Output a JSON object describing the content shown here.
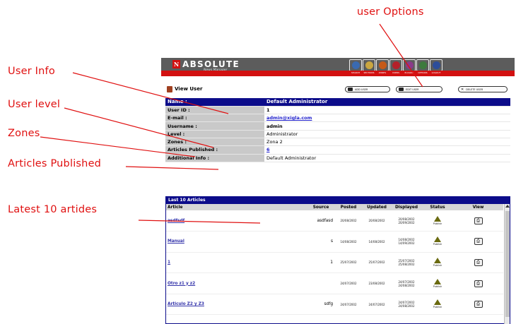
{
  "callouts": {
    "user_options": "user Options",
    "user_info": "User Info",
    "user_level": "User level",
    "zones": "Zones",
    "articles_published": "Articles Published",
    "latest": "Latest 10 artides"
  },
  "header": {
    "logo_mark": "N",
    "logo": "ABSOLUTE",
    "logo_sub": "News Manager",
    "nav": [
      {
        "label": "SEARCH",
        "icon": "search-icon",
        "color": "#3a6ab0"
      },
      {
        "label": "SECTIONS",
        "icon": "sections-icon",
        "color": "#caa640"
      },
      {
        "label": "ZONES",
        "icon": "zones-icon",
        "color": "#c65a18"
      },
      {
        "label": "USERS",
        "icon": "users-icon",
        "color": "#b4202a"
      },
      {
        "label": "PLUGINS",
        "icon": "plugins-icon",
        "color": "#8a3a8a"
      },
      {
        "label": "OPTIONS",
        "icon": "options-icon",
        "color": "#3d7a3d"
      },
      {
        "label": "LOGOUT",
        "icon": "logout-icon",
        "color": "#2d4d9a"
      }
    ]
  },
  "toolbar": {
    "title": "View User",
    "add": "ADD USER",
    "edit": "EDIT USER",
    "delete": "DELETE USER"
  },
  "info": {
    "name_label": "Name :",
    "name_value": "Default Administrator",
    "rows": [
      {
        "label": "User ID :",
        "value": "1"
      },
      {
        "label": "E-mail :",
        "value": "admin@xigla.com"
      },
      {
        "label": "Username :",
        "value": "admin"
      },
      {
        "label": "Level :",
        "value": "Administrator"
      },
      {
        "label": "Zones :",
        "value": "Zona 2"
      },
      {
        "label": "Articles Published :",
        "value": "6"
      },
      {
        "label": "Additional Info :",
        "value": "Default Administrator"
      }
    ]
  },
  "articles": {
    "title": "Last 10 Articles",
    "columns": [
      "Article",
      "Source",
      "Posted",
      "Updated",
      "Displayed",
      "Status",
      "View"
    ],
    "status_label": "Publish",
    "rows": [
      {
        "title": "asdfsdf",
        "source": "asdfasd",
        "posted": "20/08/2002",
        "updated": "20/08/2002",
        "disp1": "20/08/2002",
        "disp2": "20/09/2002"
      },
      {
        "title": "Manual",
        "source": "s",
        "posted": "14/08/2002",
        "updated": "14/08/2002",
        "disp1": "14/08/2002",
        "disp2": "14/09/2002"
      },
      {
        "title": "1",
        "source": "1",
        "posted": "25/07/2002",
        "updated": "25/07/2002",
        "disp1": "25/07/2002",
        "disp2": "25/08/2002"
      },
      {
        "title": "Otro z1 y z2",
        "source": "",
        "posted": "24/07/2002",
        "updated": "23/08/2002",
        "disp1": "24/07/2002",
        "disp2": "24/08/2002"
      },
      {
        "title": "Articulo Z2 y Z3",
        "source": "sdfg",
        "posted": "24/07/2002",
        "updated": "24/07/2002",
        "disp1": "24/07/2002",
        "disp2": "24/08/2002"
      }
    ]
  },
  "colors": {
    "callout": "#e01010",
    "accent_red": "#d21010",
    "table_head": "#0c0c8a",
    "header_grey": "#5c5c5c"
  }
}
